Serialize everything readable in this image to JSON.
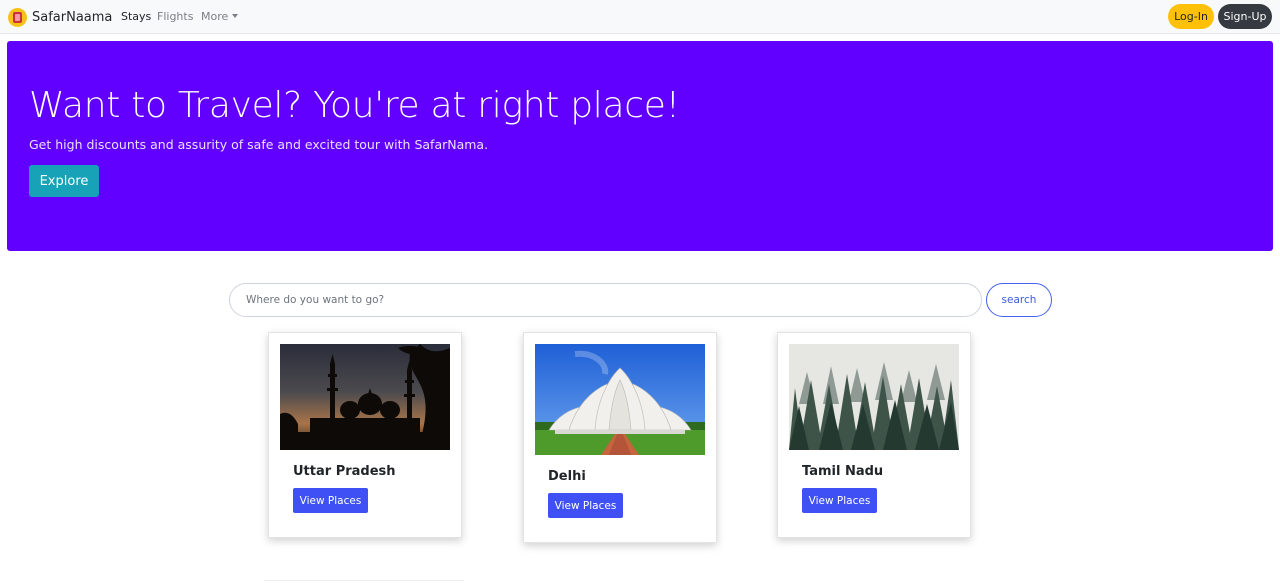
{
  "navbar": {
    "brand": "SafarNaama",
    "links": [
      {
        "label": "Stays",
        "active": true
      },
      {
        "label": "Flights",
        "active": false
      },
      {
        "label": "More",
        "active": false
      }
    ],
    "login_label": "Log-In",
    "signup_label": "Sign-Up"
  },
  "hero": {
    "title": "Want to Travel? You're at right place!",
    "subtitle": "Get high discounts and assurity of safe and excited tour with SafarNama.",
    "cta_label": "Explore",
    "background_color": "#6100ff"
  },
  "search": {
    "placeholder": "Where do you want to go?",
    "button_label": "search"
  },
  "destinations": [
    {
      "name": "Uttar Pradesh",
      "button_label": "View Places",
      "image": "mosque-silhouette-sunset"
    },
    {
      "name": "Delhi",
      "button_label": "View Places",
      "image": "lotus-temple"
    },
    {
      "name": "Tamil Nadu",
      "button_label": "View Places",
      "image": "misty-forest"
    }
  ]
}
